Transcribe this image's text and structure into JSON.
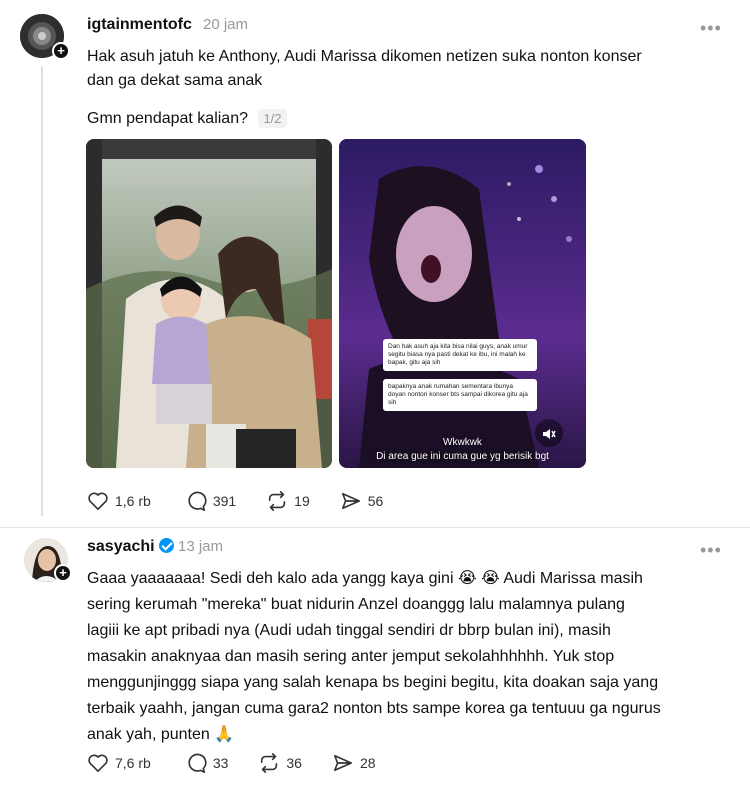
{
  "post1": {
    "username": "igtainmentofc",
    "time": "20 jam",
    "more": "•••",
    "text_line1": "Hak asuh jatuh ke Anthony, Audi Marissa dikomen netizen suka nonton konser",
    "text_line2": "dan ga dekat sama anak",
    "text_line3": "Gmn pendapat kalian?",
    "counter": "1/2",
    "image2": {
      "comment1": "Dan hak asuh aja kita bisa nilai guys, anak umur segitu biasa nya pasti dekat ke ibu, ini malah ke bapak, gitu aja sih",
      "comment2": "bapaknya anak rumahan sementara ibunya doyan nonton konser bts sampai dikorea gitu aja sih",
      "subtitle1": "Wkwkwk",
      "subtitle2": "Di area gue ini cuma gue yg berisik bgt"
    },
    "actions": {
      "likes": "1,6 rb",
      "comments": "391",
      "reposts": "19",
      "shares": "56"
    }
  },
  "post2": {
    "username": "sasyachi",
    "time": "13 jam",
    "more": "•••",
    "lines": [
      "Gaaa yaaaaaaa! Sedi deh kalo ada yangg kaya gini 😭 😭  Audi Marissa masih",
      "sering kerumah \"mereka\" buat nidurin Anzel doanggg lalu malamnya pulang",
      "lagiii ke apt pribadi nya (Audi udah tinggal sendiri dr bbrp bulan ini), masih",
      "masakin anaknyaa dan masih sering anter jemput sekolahhhhhh. Yuk stop",
      "menggunjinggg siapa yang salah kenapa bs begini begitu, kita doakan saja yang",
      "terbaik yaahh, jangan cuma gara2 nonton bts sampe korea ga tentuuu ga ngurus",
      "anak yah, punten 🙏"
    ],
    "actions": {
      "likes": "7,6 rb",
      "comments": "33",
      "reposts": "36",
      "shares": "28"
    }
  },
  "colors": {
    "verified": "#0095f6",
    "muted_text": "#999999"
  }
}
